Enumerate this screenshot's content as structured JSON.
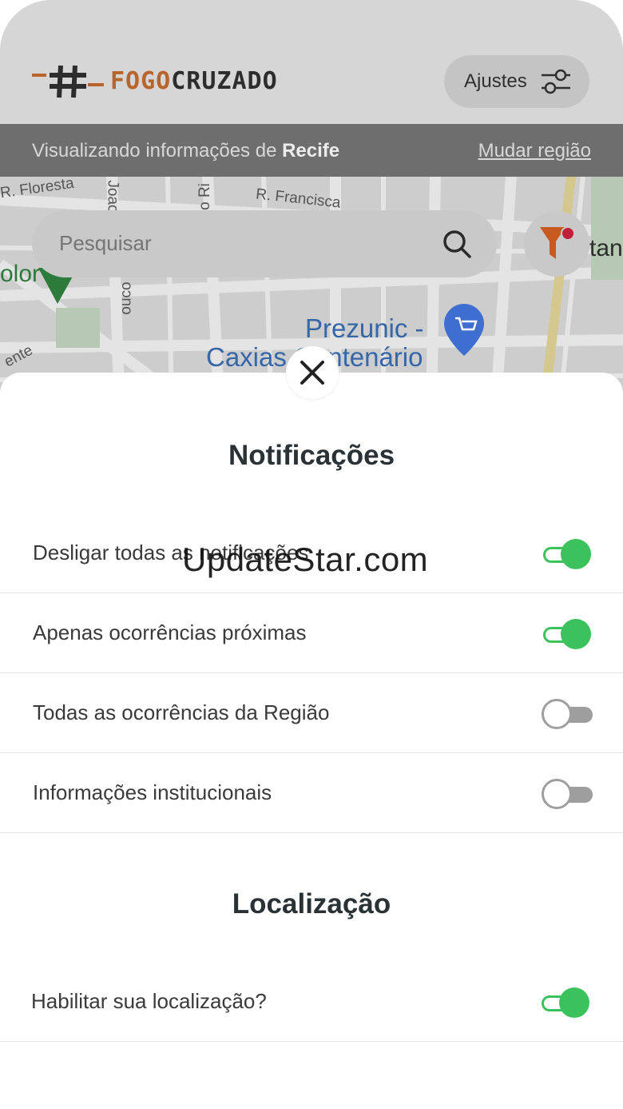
{
  "header": {
    "logo_fogo": "FOGO",
    "logo_cruzado": "CRUZADO",
    "settings_label": "Ajustes"
  },
  "region_bar": {
    "prefix": "Visualizando informações de ",
    "city": "Recife",
    "change_link": "Mudar região"
  },
  "search": {
    "placeholder": "Pesquisar"
  },
  "map": {
    "streets": [
      "R. Floresta",
      "Joao",
      "R. Francisca",
      "o Ri",
      "ouco",
      "ente",
      "tan",
      "olor"
    ],
    "place_line1": "Prezunic -",
    "place_line2": "Caxias Centenário"
  },
  "sheet": {
    "notifications_title": "Notificações",
    "notifications": [
      {
        "label": "Desligar todas as notificações",
        "on": true
      },
      {
        "label": "Apenas ocorrências próximas",
        "on": true
      },
      {
        "label": "Todas as ocorrências da Região",
        "on": false
      },
      {
        "label": "Informações institucionais",
        "on": false
      }
    ],
    "location_title": "Localização",
    "location": [
      {
        "label": "Habilitar sua localização?",
        "on": true
      }
    ]
  },
  "watermark": "UpdateStar.com",
  "colors": {
    "toggle_on": "#3cc25c",
    "toggle_off": "#9e9e9e",
    "brand_orange": "#b8652d"
  }
}
